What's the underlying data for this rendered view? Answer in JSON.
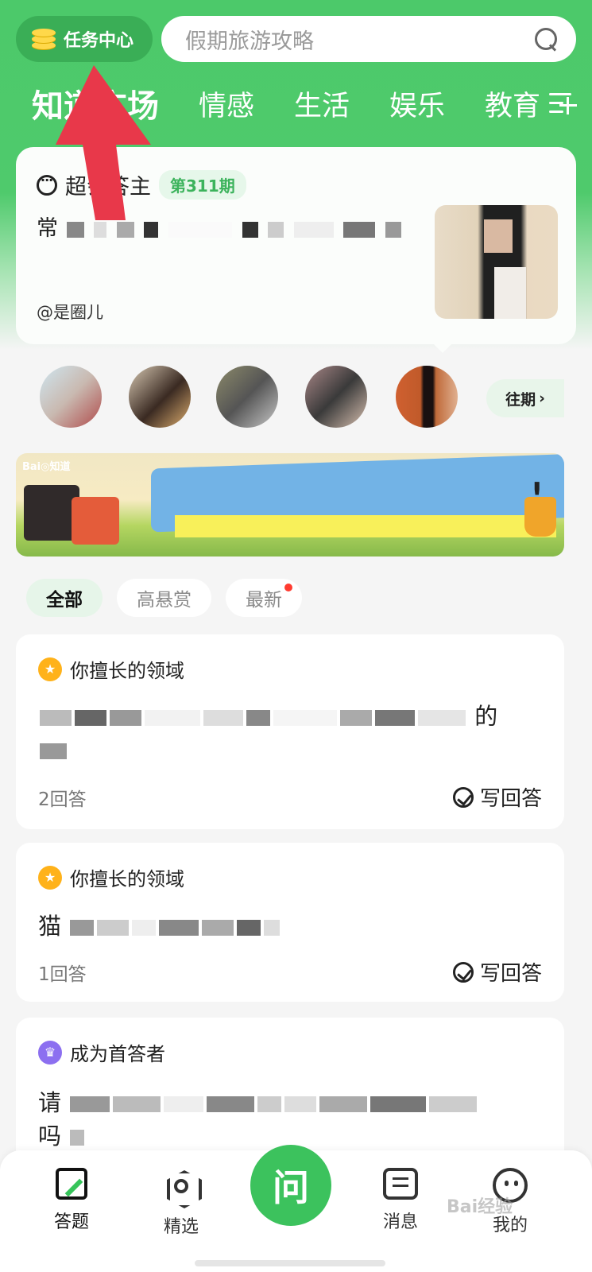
{
  "header": {
    "task_center_label": "任务中心",
    "search_placeholder": "假期旅游攻略",
    "tabs": [
      "知道广场",
      "情感",
      "生活",
      "娱乐",
      "教育"
    ]
  },
  "feature": {
    "title": "超会答主",
    "issue": "第311期",
    "question_prefix": "常",
    "author": "@是圈儿"
  },
  "past_label": "往期",
  "filters": [
    "全部",
    "高悬赏",
    "最新"
  ],
  "questions": [
    {
      "tag": "你擅长的领域",
      "text_prefix": "",
      "text_suffix": "的",
      "count": "2回答",
      "write": "写回答"
    },
    {
      "tag": "你擅长的领域",
      "text_prefix": "猫",
      "text_suffix": "",
      "count": "1回答",
      "write": "写回答"
    },
    {
      "tag": "成为首答者",
      "text_prefix": "请",
      "text_suffix": "吗",
      "count": "",
      "write": ""
    }
  ],
  "bottom_nav": {
    "answer": "答题",
    "select": "精选",
    "ask": "问",
    "message": "消息",
    "me": "我的"
  },
  "watermark": "Bai经验",
  "colors": {
    "brand_green": "#4cc96a",
    "ask_green": "#3cc25d",
    "arrow_red": "#e8384a",
    "star": "#ffb21a",
    "crown": "#8c6ff0"
  }
}
